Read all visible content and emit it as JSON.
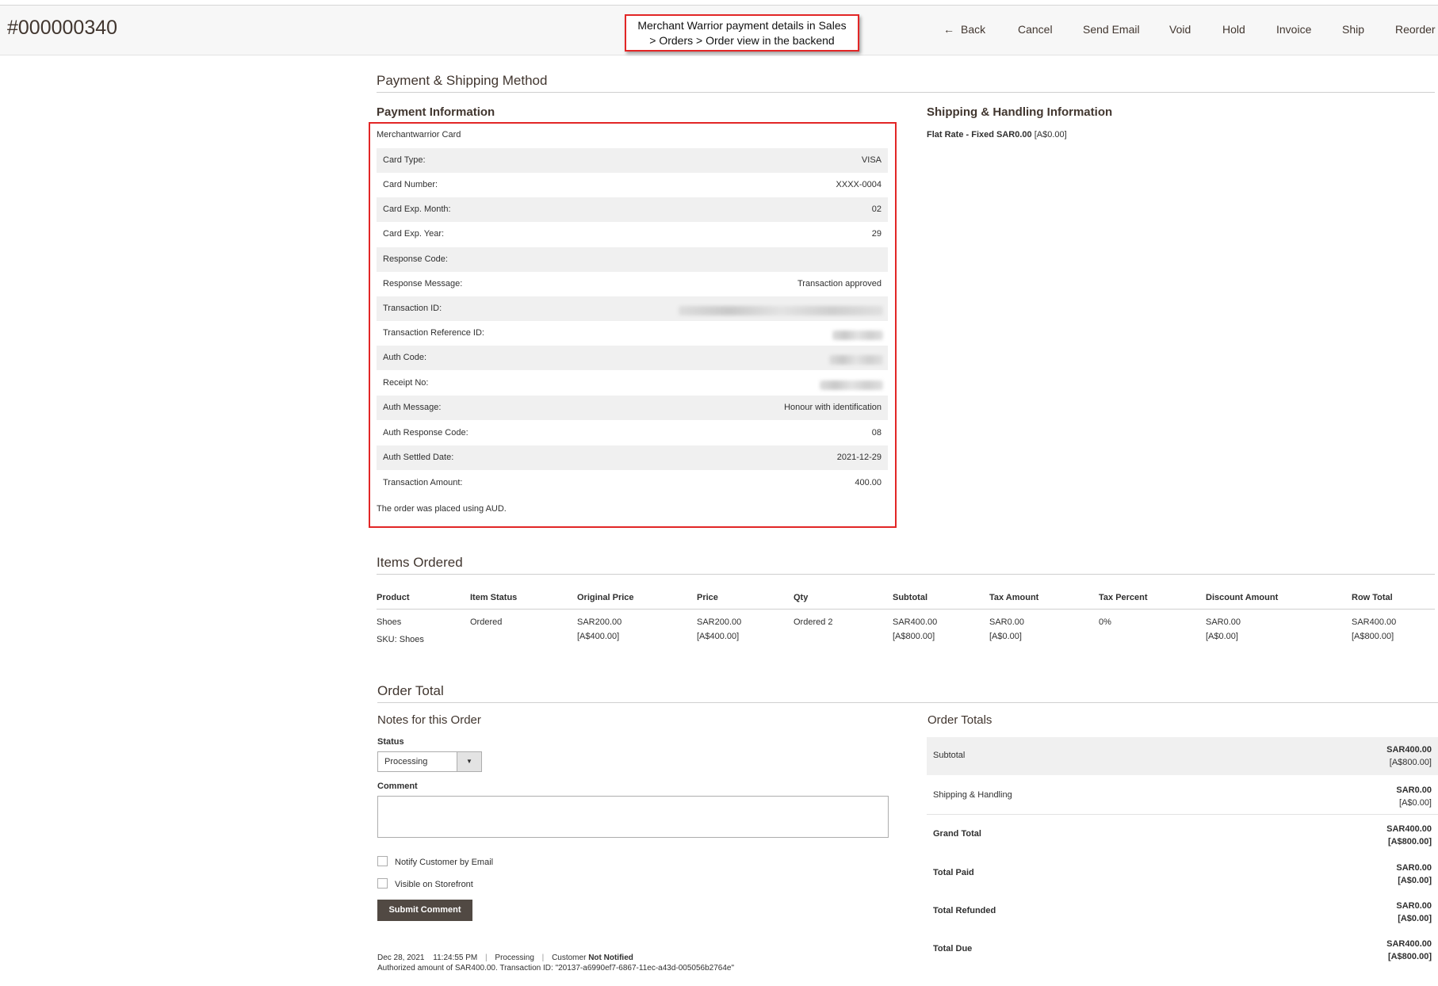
{
  "header": {
    "order_id": "#000000340",
    "annotation_line1": "Merchant Warrior payment details in Sales",
    "annotation_line2": "> Orders > Order view in the backend",
    "actions": {
      "back": "Back",
      "cancel": "Cancel",
      "send_email": "Send Email",
      "void": "Void",
      "hold": "Hold",
      "invoice": "Invoice",
      "ship": "Ship",
      "reorder": "Reorder"
    }
  },
  "payment_shipping": {
    "title": "Payment & Shipping Method",
    "payment_title": "Payment Information",
    "method": "Merchantwarrior Card",
    "rows": [
      {
        "label": "Card Type:",
        "value": "VISA"
      },
      {
        "label": "Card Number:",
        "value": "XXXX-0004"
      },
      {
        "label": "Card Exp. Month:",
        "value": "02"
      },
      {
        "label": "Card Exp. Year:",
        "value": "29"
      },
      {
        "label": "Response Code:",
        "value": ""
      },
      {
        "label": "Response Message:",
        "value": "Transaction approved"
      },
      {
        "label": "Transaction ID:",
        "value": ""
      },
      {
        "label": "Transaction Reference ID:",
        "value": ""
      },
      {
        "label": "Auth Code:",
        "value": ""
      },
      {
        "label": "Receipt No:",
        "value": ""
      },
      {
        "label": "Auth Message:",
        "value": "Honour with identification"
      },
      {
        "label": "Auth Response Code:",
        "value": "08"
      },
      {
        "label": "Auth Settled Date:",
        "value": "2021-12-29"
      },
      {
        "label": "Transaction Amount:",
        "value": "400.00"
      }
    ],
    "currency_note": "The order was placed using AUD.",
    "shipping_title": "Shipping & Handling Information",
    "shipping_method": "Flat Rate - Fixed SAR0.00",
    "shipping_base": "[A$0.00]"
  },
  "items": {
    "title": "Items Ordered",
    "headers": {
      "product": "Product",
      "status": "Item Status",
      "original_price": "Original Price",
      "price": "Price",
      "qty": "Qty",
      "subtotal": "Subtotal",
      "tax_amount": "Tax Amount",
      "tax_percent": "Tax Percent",
      "discount": "Discount Amount",
      "row_total": "Row Total"
    },
    "row": {
      "product": "Shoes",
      "sku": "SKU: Shoes",
      "status": "Ordered",
      "original_price": "SAR200.00",
      "original_price_base": "[A$400.00]",
      "price": "SAR200.00",
      "price_base": "[A$400.00]",
      "qty": "Ordered 2",
      "subtotal": "SAR400.00",
      "subtotal_base": "[A$800.00]",
      "tax_amount": "SAR0.00",
      "tax_amount_base": "[A$0.00]",
      "tax_percent": "0%",
      "discount": "SAR0.00",
      "discount_base": "[A$0.00]",
      "row_total": "SAR400.00",
      "row_total_base": "[A$800.00]"
    }
  },
  "order_total": {
    "title": "Order Total",
    "notes_title": "Notes for this Order",
    "status_label": "Status",
    "status_value": "Processing",
    "comment_label": "Comment",
    "notify_label": "Notify Customer by Email",
    "visible_label": "Visible on Storefront",
    "submit_label": "Submit Comment",
    "history": {
      "date": "Dec 28, 2021",
      "time": "11:24:55 PM",
      "status": "Processing",
      "customer_label": "Customer",
      "customer_state": "Not Notified",
      "comment": "Authorized amount of SAR400.00. Transaction ID: \"20137-a6990ef7-6867-11ec-a43d-005056b2764e\""
    },
    "totals_title": "Order Totals",
    "totals": [
      {
        "label": "Subtotal",
        "value": "SAR400.00",
        "base": "[A$800.00]"
      },
      {
        "label": "Shipping & Handling",
        "value": "SAR0.00",
        "base": "[A$0.00]"
      },
      {
        "label": "Grand Total",
        "value": "SAR400.00",
        "base": "[A$800.00]"
      },
      {
        "label": "Total Paid",
        "value": "SAR0.00",
        "base": "[A$0.00]"
      },
      {
        "label": "Total Refunded",
        "value": "SAR0.00",
        "base": "[A$0.00]"
      },
      {
        "label": "Total Due",
        "value": "SAR400.00",
        "base": "[A$800.00]"
      }
    ]
  }
}
